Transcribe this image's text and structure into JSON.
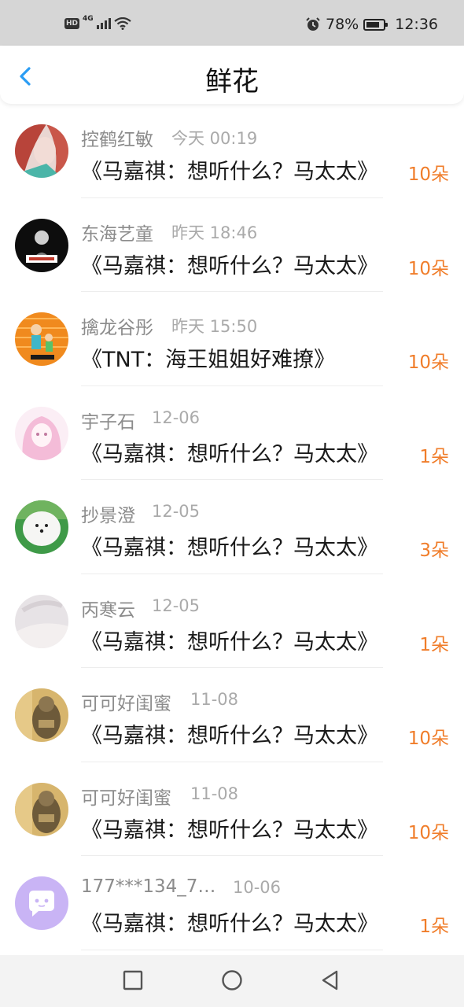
{
  "status_bar": {
    "hd": "HD",
    "network": "4G",
    "battery": "78%",
    "battery_level": 0.78,
    "time": "12:36"
  },
  "header": {
    "title": "鲜花"
  },
  "colors": {
    "accent_blue": "#2a9df4",
    "flower_orange": "#f07d2a"
  },
  "items": [
    {
      "name": "控鹤红敏",
      "date": "今天 00:19",
      "work": "《马嘉祺：想听什么？马太太》",
      "flowers": "10朵",
      "avatar": "red-hair-girl-avatar"
    },
    {
      "name": "东海艺童",
      "date": "昨天 18:46",
      "work": "《马嘉祺：想听什么？马太太》",
      "flowers": "10朵",
      "avatar": "dark-figure-avatar"
    },
    {
      "name": "擒龙谷彤",
      "date": "昨天 15:50",
      "work": "《TNT：海王姐姐好难撩》",
      "flowers": "10朵",
      "avatar": "cartoon-kids-avatar"
    },
    {
      "name": "宇子石",
      "date": "12-06",
      "work": "《马嘉祺：想听什么？马太太》",
      "flowers": "1朵",
      "avatar": "pink-anime-girl-avatar"
    },
    {
      "name": "抄景澄",
      "date": "12-05",
      "work": "《马嘉祺：想听什么？马太太》",
      "flowers": "3朵",
      "avatar": "white-dog-avatar"
    },
    {
      "name": "丙寒云",
      "date": "12-05",
      "work": "《马嘉祺：想听什么？马太太》",
      "flowers": "1朵",
      "avatar": "pale-hand-avatar"
    },
    {
      "name": "可可好闺蜜",
      "date": "11-08",
      "work": "《马嘉祺：想听什么？马太太》",
      "flowers": "10朵",
      "avatar": "bear-figure-avatar"
    },
    {
      "name": "可可好闺蜜",
      "date": "11-08",
      "work": "《马嘉祺：想听什么？马太太》",
      "flowers": "10朵",
      "avatar": "bear-figure-avatar"
    },
    {
      "name": "177***134_7…",
      "date": "10-06",
      "work": "《马嘉祺：想听什么？马太太》",
      "flowers": "1朵",
      "avatar": "purple-chat-avatar"
    }
  ],
  "nav": {
    "recent": "square-icon",
    "home": "circle-icon",
    "back": "triangle-back-icon"
  }
}
